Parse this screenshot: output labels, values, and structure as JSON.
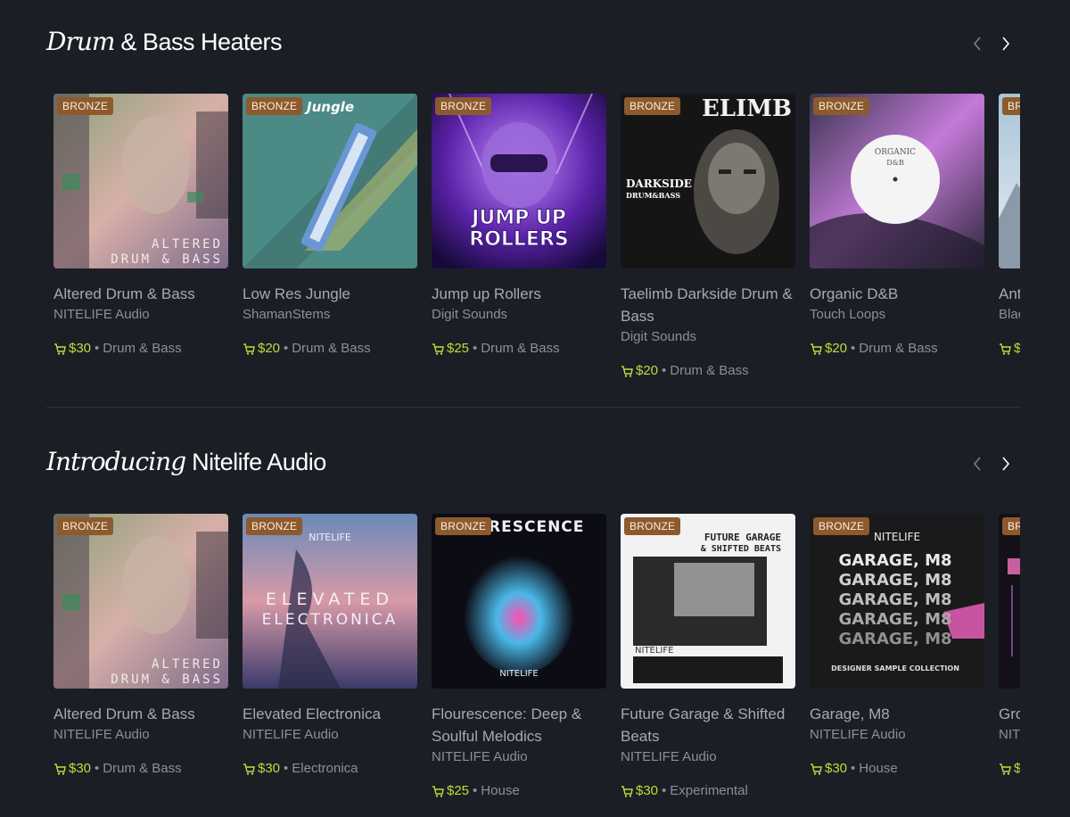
{
  "colors": {
    "background": "#1c1e26",
    "badge": "#8c5a2c",
    "price": "#b8e03a"
  },
  "sections": [
    {
      "heading_italic": "Drum",
      "heading_rest": " & Bass Heaters",
      "cards": [
        {
          "badge": "BRONZE",
          "title": "Altered Drum & Bass",
          "artist": "NITELIFE Audio",
          "price": "$30",
          "genre": "Drum & Bass",
          "cover_text": "ALTERED DRUM & BASS"
        },
        {
          "badge": "BRONZE",
          "title": "Low Res Jungle",
          "artist": "ShamanStems",
          "price": "$20",
          "genre": "Drum & Bass",
          "cover_text": "Jungle"
        },
        {
          "badge": "BRONZE",
          "title": "Jump up Rollers",
          "artist": "Digit Sounds",
          "price": "$25",
          "genre": "Drum & Bass",
          "cover_text": "JUMP UP ROLLERS"
        },
        {
          "badge": "BRONZE",
          "title": "Taelimb Darkside Drum & Bass",
          "artist": "Digit Sounds",
          "price": "$20",
          "genre": "Drum & Bass",
          "cover_text": "ELIMB"
        },
        {
          "badge": "BRONZE",
          "title": "Organic D&B",
          "artist": "Touch Loops",
          "price": "$20",
          "genre": "Drum & Bass",
          "cover_text": "ORGANIC D&B"
        },
        {
          "badge": "BRONZE",
          "title": "Ant",
          "artist": "Blac",
          "price": "$",
          "genre": ""
        }
      ]
    },
    {
      "heading_italic": "Introducing",
      "heading_rest": " Nitelife Audio",
      "cards": [
        {
          "badge": "BRONZE",
          "title": "Altered Drum & Bass",
          "artist": "NITELIFE Audio",
          "price": "$30",
          "genre": "Drum & Bass",
          "cover_text": "ALTERED DRUM & BASS"
        },
        {
          "badge": "BRONZE",
          "title": "Elevated Electronica",
          "artist": "NITELIFE Audio",
          "price": "$30",
          "genre": "Electronica",
          "cover_text": "ELEVATED ELECTRONICA"
        },
        {
          "badge": "BRONZE",
          "title": "Flourescence: Deep & Soulful Melodics",
          "artist": "NITELIFE Audio",
          "price": "$25",
          "genre": "House",
          "cover_text": "ORESCENCE"
        },
        {
          "badge": "BRONZE",
          "title": "Future Garage & Shifted Beats",
          "artist": "NITELIFE Audio",
          "price": "$30",
          "genre": "Experimental",
          "cover_text": "FUTURE GARAGE & SHIFTED BEATS"
        },
        {
          "badge": "BRONZE",
          "title": "Garage, M8",
          "artist": "NITELIFE Audio",
          "price": "$30",
          "genre": "House",
          "cover_text": "GARAGE, M8"
        },
        {
          "badge": "BRONZE",
          "title": "Gro",
          "artist": "NITI",
          "price": "$",
          "genre": ""
        }
      ]
    }
  ]
}
